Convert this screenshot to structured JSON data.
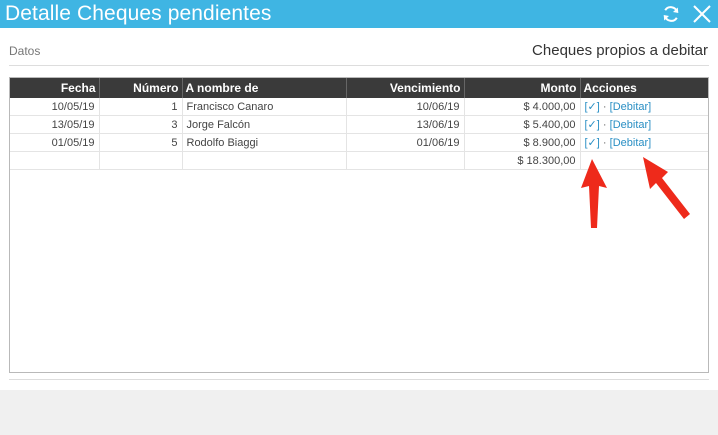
{
  "window": {
    "title": "Detalle Cheques pendientes",
    "title_bar_color": "#3fb5e3"
  },
  "header": {
    "section_label": "Datos",
    "section_title": "Cheques propios a debitar"
  },
  "table": {
    "columns": {
      "fecha": "Fecha",
      "numero": "Número",
      "nombre": "A nombre de",
      "vencimiento": "Vencimiento",
      "monto": "Monto",
      "acciones": "Acciones"
    },
    "rows": [
      {
        "fecha": "10/05/19",
        "numero": "1",
        "nombre": "Francisco Canaro",
        "vencimiento": "10/06/19",
        "monto": "$ 4.000,00",
        "check": "[✓]",
        "sep": "·",
        "debitar": "[Debitar]"
      },
      {
        "fecha": "13/05/19",
        "numero": "3",
        "nombre": "Jorge Falcón",
        "vencimiento": "13/06/19",
        "monto": "$ 5.400,00",
        "check": "[✓]",
        "sep": "·",
        "debitar": "[Debitar]"
      },
      {
        "fecha": "01/05/19",
        "numero": "5",
        "nombre": "Rodolfo Biaggi",
        "vencimiento": "01/06/19",
        "monto": "$ 8.900,00",
        "check": "[✓]",
        "sep": "·",
        "debitar": "[Debitar]"
      }
    ],
    "total": "$ 18.300,00"
  },
  "icons": {
    "refresh": "refresh-icon",
    "close": "close-icon"
  },
  "colors": {
    "accent": "#3fb5e3",
    "link": "#2a8fc4",
    "annotation_arrow": "#ee2a1b",
    "header_bg": "#3a3a3a"
  }
}
